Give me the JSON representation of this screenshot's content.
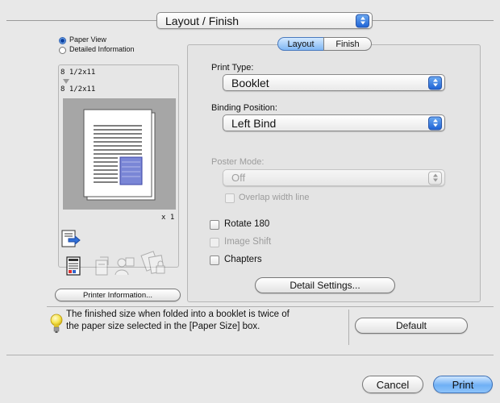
{
  "top": {
    "popup_label": "Layout / Finish"
  },
  "left": {
    "view_options": [
      "Paper View",
      "Detailed Information"
    ],
    "selected_view": "Paper View",
    "paper_size_top": "8 1/2x11",
    "paper_size_bottom": "8 1/2x11",
    "copies": "x 1",
    "printer_info_button": "Printer Information..."
  },
  "tabs": [
    "Layout",
    "Finish"
  ],
  "selected_tab": "Layout",
  "settings": {
    "print_type_label": "Print Type:",
    "print_type_value": "Booklet",
    "binding_label": "Binding Position:",
    "binding_value": "Left Bind",
    "poster_label": "Poster Mode:",
    "poster_value": "Off",
    "overlap_label": "Overlap width line",
    "rotate_label": "Rotate 180",
    "image_shift_label": "Image Shift",
    "chapters_label": "Chapters",
    "detail_button": "Detail Settings..."
  },
  "hint": {
    "line1": "The finished size when folded into a booklet is twice of",
    "line2": "the paper size selected in the [Paper Size] box."
  },
  "default_button": "Default",
  "cancel_button": "Cancel",
  "print_button": "Print",
  "colors": {
    "accent": "#3f7fe0",
    "panel": "#e4e4e4",
    "background": "#e8e8e8"
  }
}
